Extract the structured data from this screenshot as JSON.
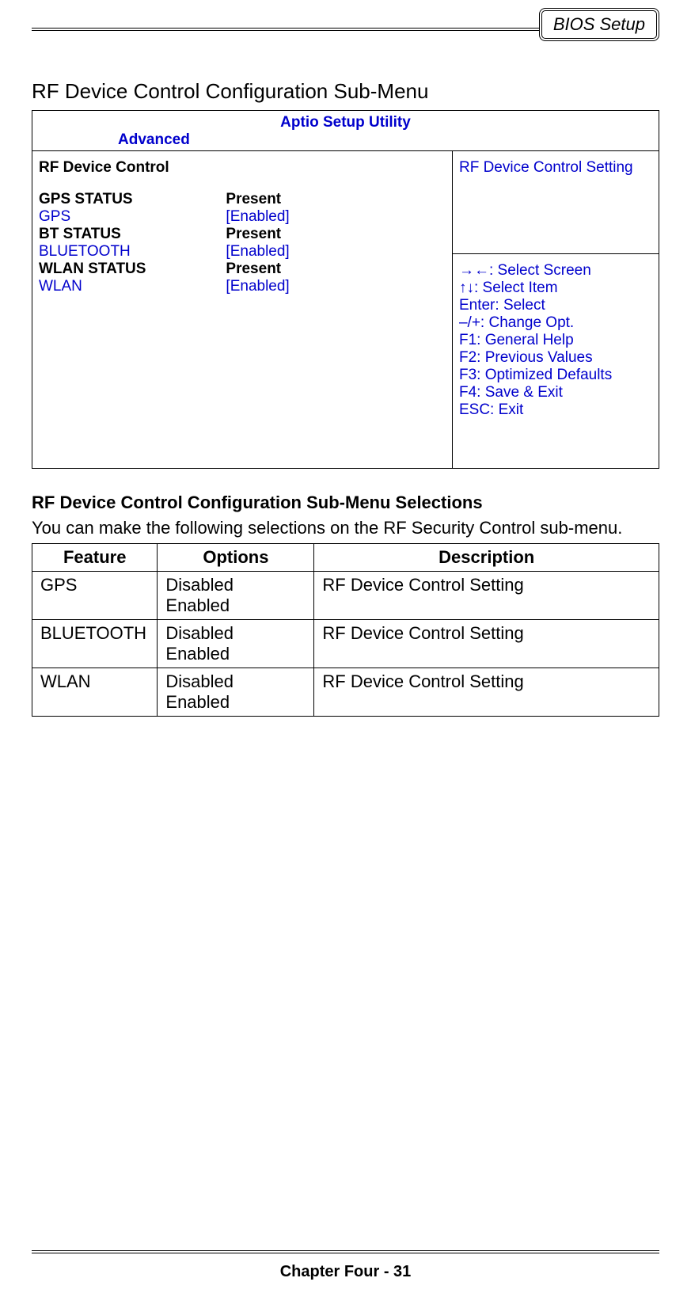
{
  "header": {
    "badge": "BIOS Setup"
  },
  "section_heading": "RF Device Control Configuration Sub-Menu",
  "bios": {
    "utility_title": "Aptio Setup Utility",
    "tab": "Advanced",
    "left_heading": "RF Device Control",
    "rows": [
      {
        "label": "GPS STATUS",
        "value": "Present",
        "label_class": "bold",
        "value_class": "bold"
      },
      {
        "label": "GPS",
        "value": "[Enabled]",
        "label_class": "blue",
        "value_class": "blue"
      },
      {
        "label": "BT STATUS",
        "value": "Present",
        "label_class": "bold",
        "value_class": "bold"
      },
      {
        "label": "BLUETOOTH",
        "value": "[Enabled]",
        "label_class": "blue",
        "value_class": "blue"
      },
      {
        "label": "WLAN STATUS",
        "value": "Present",
        "label_class": "bold",
        "value_class": "bold"
      },
      {
        "label": "WLAN",
        "value": "[Enabled]",
        "label_class": "blue",
        "value_class": "blue"
      }
    ],
    "help_top": "RF Device Control Setting",
    "keys": [
      "→←: Select Screen",
      "↑↓: Select Item",
      "Enter: Select",
      "–/+: Change Opt.",
      "F1: General Help",
      "F2: Previous Values",
      "F3: Optimized Defaults",
      "F4: Save & Exit",
      "ESC: Exit"
    ]
  },
  "selections": {
    "heading": "RF Device Control Configuration Sub-Menu Selections",
    "intro": "You can make the following selections on the RF Security Control sub-menu.",
    "headers": {
      "feature": "Feature",
      "options": "Options",
      "description": "Description"
    },
    "rows": [
      {
        "feature": "GPS",
        "options": [
          "Disabled",
          "Enabled"
        ],
        "description": "RF Device Control Setting"
      },
      {
        "feature": "BLUETOOTH",
        "options": [
          "Disabled",
          "Enabled"
        ],
        "description": "RF Device Control Setting"
      },
      {
        "feature": "WLAN",
        "options": [
          "Disabled",
          "Enabled"
        ],
        "description": "RF Device Control Setting"
      }
    ]
  },
  "footer": "Chapter Four - 31"
}
